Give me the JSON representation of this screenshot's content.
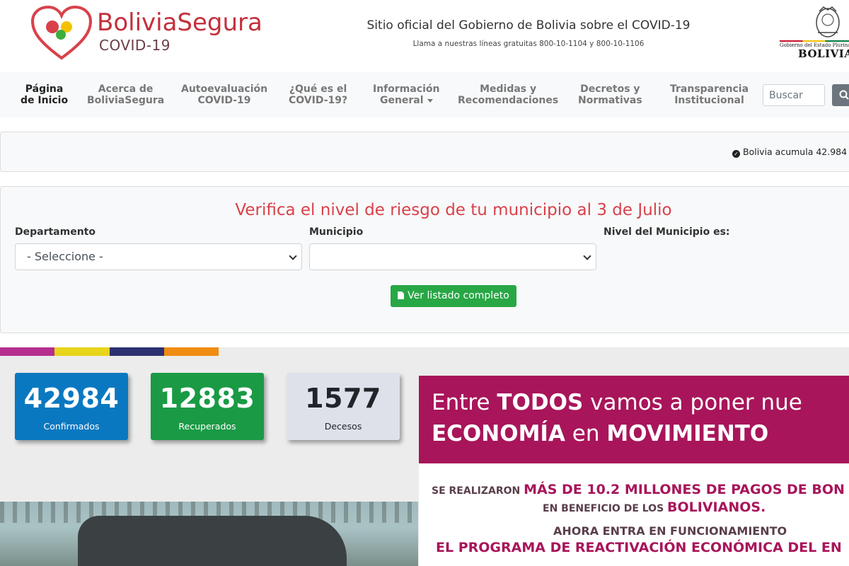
{
  "header": {
    "brand_name": "BoliviaSegura",
    "brand_sub": "COVID-19",
    "site_title": "Sitio oficial del Gobierno de Bolivia sobre el COVID-19",
    "hotlines": "Llama a nuestras líneas gratuitas 800-10-1104 y 800-10-1106",
    "gov_small": "Gobierno del Estado Plurinacional de",
    "gov_big": "BOLIVIA",
    "heart_icon": "heart-logo-icon",
    "colors": {
      "brand": "#c42f3b",
      "heart_red": "#d9414a",
      "heart_yellow": "#f2c200",
      "heart_green": "#3cae3a"
    }
  },
  "nav": {
    "items": [
      {
        "line1": "Página",
        "line2": "de Inicio",
        "active": true
      },
      {
        "line1": "Acerca de",
        "line2": "BoliviaSegura"
      },
      {
        "line1": "Autoevaluación",
        "line2": "COVID-19"
      },
      {
        "line1": "¿Qué es el",
        "line2": "COVID-19?"
      },
      {
        "line1": "Información",
        "line2": "General",
        "dropdown": true
      },
      {
        "line1": "Medidas y",
        "line2": "Recomendaciones"
      },
      {
        "line1": "Decretos y",
        "line2": "Normativas"
      },
      {
        "line1": "Transparencia",
        "line2": "Institucional"
      }
    ],
    "search_placeholder": "Buscar",
    "search_icon": "search-icon"
  },
  "ticker": {
    "text": "Bolivia acumula 42.984",
    "icon": "check-circle-icon"
  },
  "risk": {
    "title": "Verifica el nivel de riesgo de tu municipio al 3 de Julio",
    "departamento_label": "Departamento",
    "departamento_value": "- Seleccione -",
    "municipio_label": "Municipio",
    "municipio_value": "",
    "nivel_label": "Nivel del Municipio es:",
    "button_label": "Ver listado completo",
    "button_icon": "file-icon",
    "title_color": "#d9414a",
    "button_color": "#28a745"
  },
  "stripe_colors": [
    "#b52f8f",
    "#e8d41a",
    "#2d3172",
    "#f08c12"
  ],
  "stats": [
    {
      "value": "42984",
      "label": "Confirmados",
      "bg": "#0a78c0",
      "fg": "#ffffff"
    },
    {
      "value": "12883",
      "label": "Recuperados",
      "bg": "#1a9a45",
      "fg": "#ffffff"
    },
    {
      "value": "1577",
      "label": "Decesos",
      "bg": "#dfe1ea",
      "fg": "#212529"
    }
  ],
  "banner": {
    "line1_pre": "Entre ",
    "line1_bold": "TODOS",
    "line1_post": " vamos a poner nue",
    "line2_bold": "ECONOMÍA",
    "line2_mid": " en ",
    "line2_bold2": "MOVIMIENTO",
    "line3_pre": "SE REALIZARON ",
    "line3_big": "MÁS DE 10.2 MILLONES DE PAGOS DE BON",
    "line4_pre": "EN BENEFICIO DE LOS ",
    "line4_big": "BOLIVIANOS.",
    "line5": "AHORA ENTRA EN FUNCIONAMIENTO",
    "line6": "EL PROGRAMA DE REACTIVACIÓN ECONÓMICA DEL EN",
    "color": "#a8155a"
  }
}
